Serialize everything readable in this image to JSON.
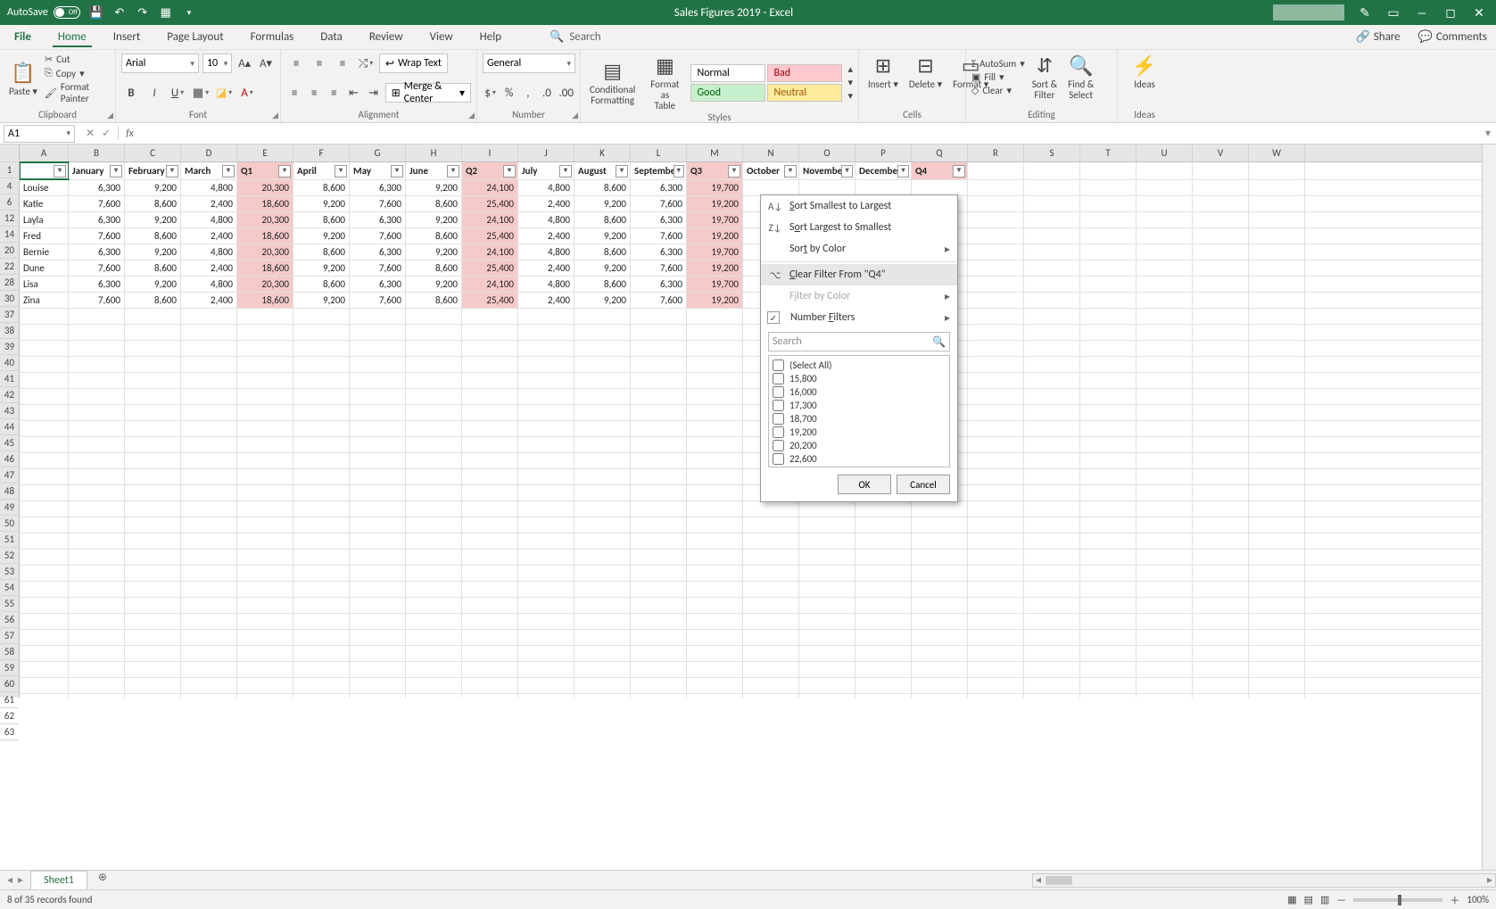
{
  "titlebar": {
    "autosave": "AutoSave",
    "autosave_state": "Off",
    "title": "Sales Figures 2019 - Excel"
  },
  "tabs": [
    "File",
    "Home",
    "Insert",
    "Page Layout",
    "Formulas",
    "Data",
    "Review",
    "View",
    "Help"
  ],
  "search_placeholder": "Search",
  "share": "Share",
  "comments": "Comments",
  "clipboard": {
    "paste": "Paste",
    "cut": "Cut",
    "copy": "Copy",
    "fmtpainter": "Format Painter",
    "label": "Clipboard"
  },
  "font": {
    "name": "Arial",
    "size": "10",
    "label": "Font"
  },
  "alignment": {
    "wrap": "Wrap Text",
    "merge": "Merge & Center",
    "label": "Alignment"
  },
  "number": {
    "fmt": "General",
    "label": "Number"
  },
  "styles": {
    "cond": "Conditional\nFormatting",
    "fat": "Format as\nTable",
    "normal": "Normal",
    "bad": "Bad",
    "good": "Good",
    "neutral": "Neutral",
    "label": "Styles"
  },
  "cells": {
    "insert": "Insert",
    "delete": "Delete",
    "format": "Format",
    "label": "Cells"
  },
  "editing": {
    "autosum": "AutoSum",
    "fill": "Fill",
    "clear": "Clear",
    "sort": "Sort &\nFilter",
    "find": "Find &\nSelect",
    "label": "Editing"
  },
  "ideas": {
    "ideas": "Ideas",
    "label": "Ideas"
  },
  "namebox": "A1",
  "columns_letters": [
    "A",
    "B",
    "C",
    "D",
    "E",
    "F",
    "G",
    "H",
    "I",
    "J",
    "K",
    "L",
    "M",
    "N",
    "O",
    "P",
    "Q",
    "R",
    "S",
    "T",
    "U",
    "V",
    "W"
  ],
  "headers": [
    "",
    "January",
    "February",
    "March",
    "Q1",
    "April",
    "May",
    "June",
    "Q2",
    "July",
    "August",
    "September",
    "Q3",
    "October",
    "November",
    "December",
    "Q4"
  ],
  "row_numbers": [
    "1",
    "4",
    "6",
    "12",
    "14",
    "20",
    "22",
    "28",
    "30",
    "37",
    "38",
    "39",
    "40",
    "41",
    "42",
    "43",
    "44",
    "45",
    "46",
    "47",
    "48",
    "49",
    "50",
    "51",
    "52",
    "53",
    "54",
    "55",
    "56",
    "57",
    "58",
    "59",
    "60",
    "61",
    "62",
    "63"
  ],
  "data_rows": [
    {
      "name": "Louise",
      "vals": [
        "6,300",
        "9,200",
        "4,800",
        "20,300",
        "8,600",
        "6,300",
        "9,200",
        "24,100",
        "4,800",
        "8,600",
        "6,300",
        "19,700"
      ]
    },
    {
      "name": "Katie",
      "vals": [
        "7,600",
        "8,600",
        "2,400",
        "18,600",
        "9,200",
        "7,600",
        "8,600",
        "25,400",
        "2,400",
        "9,200",
        "7,600",
        "19,200"
      ]
    },
    {
      "name": "Layla",
      "vals": [
        "6,300",
        "9,200",
        "4,800",
        "20,300",
        "8,600",
        "6,300",
        "9,200",
        "24,100",
        "4,800",
        "8,600",
        "6,300",
        "19,700"
      ]
    },
    {
      "name": "Fred",
      "vals": [
        "7,600",
        "8,600",
        "2,400",
        "18,600",
        "9,200",
        "7,600",
        "8,600",
        "25,400",
        "2,400",
        "9,200",
        "7,600",
        "19,200"
      ]
    },
    {
      "name": "Bernie",
      "vals": [
        "6,300",
        "9,200",
        "4,800",
        "20,300",
        "8,600",
        "6,300",
        "9,200",
        "24,100",
        "4,800",
        "8,600",
        "6,300",
        "19,700"
      ]
    },
    {
      "name": "Dune",
      "vals": [
        "7,600",
        "8,600",
        "2,400",
        "18,600",
        "9,200",
        "7,600",
        "8,600",
        "25,400",
        "2,400",
        "9,200",
        "7,600",
        "19,200"
      ]
    },
    {
      "name": "Lisa",
      "vals": [
        "6,300",
        "9,200",
        "4,800",
        "20,300",
        "8,600",
        "6,300",
        "9,200",
        "24,100",
        "4,800",
        "8,600",
        "6,300",
        "19,700"
      ]
    },
    {
      "name": "Zina",
      "vals": [
        "7,600",
        "8,600",
        "2,400",
        "18,600",
        "9,200",
        "7,600",
        "8,600",
        "25,400",
        "2,400",
        "9,200",
        "7,600",
        "19,200"
      ]
    }
  ],
  "q_cols": [
    4,
    8,
    12
  ],
  "filter_popup": {
    "sort_asc": "Sort Smallest to Largest",
    "sort_desc": "Sort Largest to Smallest",
    "sort_color": "Sort by Color",
    "clear": "Clear Filter From \"Q4\"",
    "filter_color": "Filter by Color",
    "num_filters": "Number Filters",
    "search": "Search",
    "opts": [
      "(Select All)",
      "15,800",
      "16,000",
      "17,300",
      "18,700",
      "19,200",
      "20,200",
      "22,600"
    ],
    "ok": "OK",
    "cancel": "Cancel"
  },
  "sheet_tab": "Sheet1",
  "status": "8 of 35 records found",
  "zoom": "100%"
}
